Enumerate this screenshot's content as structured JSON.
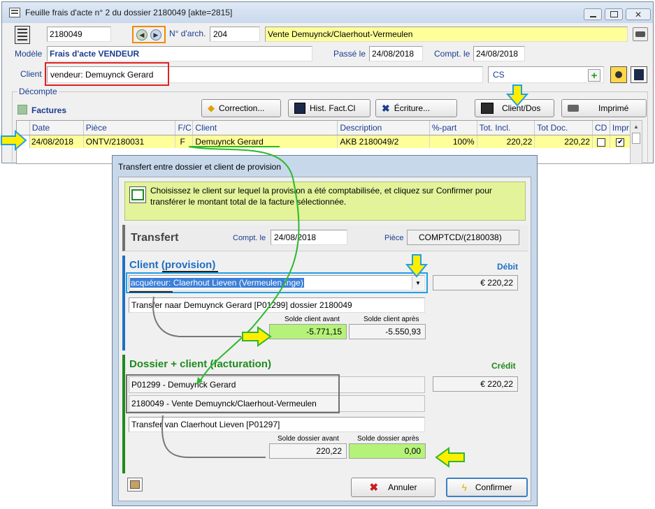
{
  "main": {
    "title": "Feuille frais d'acte n° 2 du dossier 2180049 [akte=2815]",
    "dossier_number": "2180049",
    "archive_label": "N° d'arch.",
    "archive_value": "204",
    "vente": "Vente Demuynck/Claerhout-Vermeulen",
    "modele_label": "Modèle",
    "modele_value": "Frais d'acte VENDEUR",
    "passe_label": "Passé le",
    "passe_value": "24/08/2018",
    "compt_label": "Compt. le",
    "compt_value": "24/08/2018",
    "client_label": "Client",
    "client_value": "vendeur: Demuynck Gerard",
    "cs_value": "CS",
    "decompte_label": "Décompte",
    "factures_label": "Factures",
    "buttons": {
      "correction": "Correction...",
      "hist": "Hist. Fact.Cl",
      "ecriture": "Écriture...",
      "client_dos": "Client/Dos",
      "imprime": "Imprimé"
    },
    "table": {
      "headers": [
        "Date",
        "Pièce",
        "F/C",
        "Client",
        "Description",
        "%-part",
        "Tot. Incl.",
        "Tot Doc.",
        "CD",
        "Impr"
      ],
      "row": {
        "date": "24/08/2018",
        "piece": "ONTV/2180031",
        "fc": "F",
        "client": "Demuynck Gerard",
        "description": "AKB 2180049/2",
        "part": "100%",
        "tot_incl": "220,22",
        "tot_doc": "220,22"
      }
    }
  },
  "dialog": {
    "title": "Transfert entre dossier et client de provision",
    "info": "Choisissez le client sur lequel la provision a été comptabilisée, et cliquez sur Confirmer pour transférer le montant total de la facture sélectionnée.",
    "transfert_label": "Transfert",
    "compt_label": "Compt. le",
    "compt_value": "24/08/2018",
    "piece_label": "Pièce",
    "piece_value": "COMPTCD/(2180038)",
    "client_prov_title": "Client (provision)",
    "debit_label": "Débit",
    "client_select": "acquéreur: Claerhout Lieven (Vermeulen Inge)",
    "debit_amount": "€ 220,22",
    "transfer_desc1": "Transfer naar Demuynck Gerard [P01299] dossier 2180049",
    "solde_avant_label": "Solde client avant",
    "solde_apres_label": "Solde client après",
    "solde_avant": "-5.771,15",
    "solde_apres": "-5.550,93",
    "dossier_title": "Dossier + client (facturation)",
    "credit_label": "Crédit",
    "client_line": "P01299 - Demuynck Gerard",
    "dossier_line": "2180049 - Vente Demuynck/Claerhout-Vermeulen",
    "credit_amount": "€ 220,22",
    "transfer_desc2": "Transfer van Claerhout Lieven [P01297]",
    "solde_dossier_avant_label": "Solde dossier avant",
    "solde_dossier_apres_label": "Solde dossier après",
    "solde_dossier_avant": "220,22",
    "solde_dossier_apres": "0,00",
    "annuler": "Annuler",
    "confirmer": "Confirmer"
  },
  "colors": {
    "yellow_field": "#ffff99",
    "green_field": "#b5f27a",
    "info_bg": "#e2f39a",
    "blue_section": "#1f6fc4",
    "green_section": "#1e8a1e",
    "arrow_yellow": "#ffee00",
    "arrow_green": "#2eb82e"
  }
}
